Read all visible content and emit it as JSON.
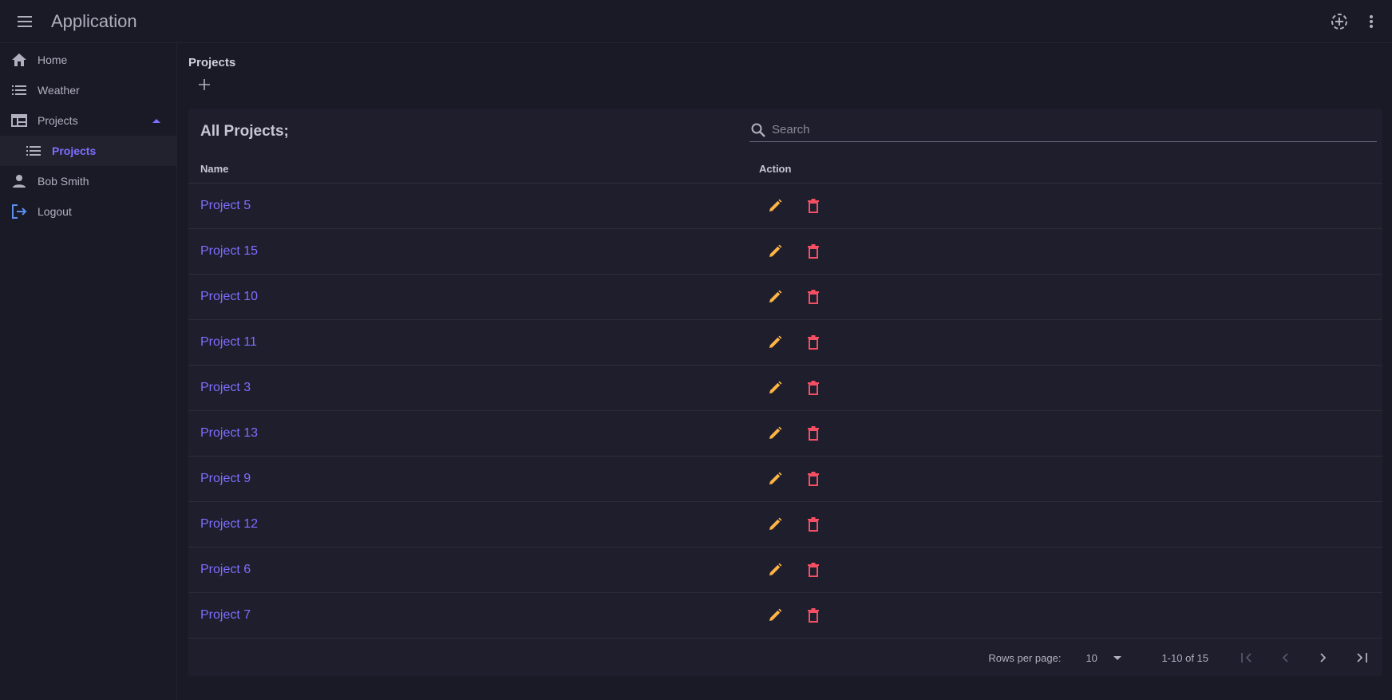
{
  "appbar": {
    "title": "Application",
    "icons": [
      "menu-icon",
      "add-circle-icon",
      "more-vert-icon"
    ]
  },
  "sidebar": {
    "items": [
      {
        "label": "Home",
        "icon": "home-icon"
      },
      {
        "label": "Weather",
        "icon": "list-icon"
      },
      {
        "label": "Projects",
        "icon": "table-icon",
        "expanded": true
      },
      {
        "label": "Projects",
        "icon": "list-icon",
        "active": true
      },
      {
        "label": "Bob Smith",
        "icon": "person-icon"
      },
      {
        "label": "Logout",
        "icon": "logout-icon"
      }
    ]
  },
  "main": {
    "page_title": "Projects",
    "card_title": "All Projects;",
    "search_placeholder": "Search",
    "columns": {
      "name": "Name",
      "action": "Action"
    },
    "rows": [
      {
        "name": "Project 5"
      },
      {
        "name": "Project 15"
      },
      {
        "name": "Project 10"
      },
      {
        "name": "Project 11"
      },
      {
        "name": "Project 3"
      },
      {
        "name": "Project 13"
      },
      {
        "name": "Project 9"
      },
      {
        "name": "Project 12"
      },
      {
        "name": "Project 6"
      },
      {
        "name": "Project 7"
      }
    ]
  },
  "pagination": {
    "rows_per_page_label": "Rows per page:",
    "rows_per_page_value": "10",
    "range": "1-10 of 15"
  },
  "colors": {
    "accent": "#7e6fff",
    "edit": "#ffb545",
    "delete": "#f64e62",
    "background": "#1a1a27",
    "surface": "#1e1e2d"
  }
}
